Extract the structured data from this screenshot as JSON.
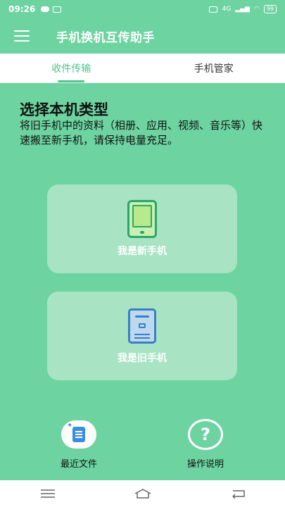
{
  "status_bar": {
    "time": "09:26",
    "battery": "99",
    "network": "4G"
  },
  "header": {
    "title": "手机换机互传助手"
  },
  "tabs": [
    {
      "label": "收件传输",
      "active": true
    },
    {
      "label": "手机管家",
      "active": false
    }
  ],
  "main": {
    "title": "选择本机类型",
    "description": "将旧手机中的资料（相册、应用、视频、音乐等）快速搬至新手机，请保持电量充足。"
  },
  "cards": {
    "new_phone": "我是新手机",
    "old_phone": "我是旧手机"
  },
  "bottom": {
    "recent_files": "最近文件",
    "instructions": "操作说明",
    "help_symbol": "?"
  },
  "colors": {
    "background": "#6dd4a1",
    "accent": "#4cc590",
    "card": "#a8e3c3"
  }
}
